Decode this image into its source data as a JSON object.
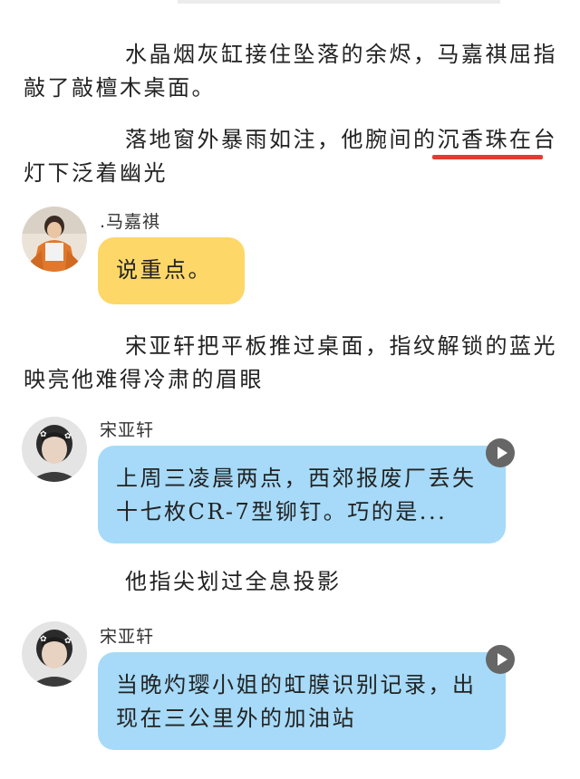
{
  "narration": [
    {
      "text": "水晶烟灰缸接住坠落的余烬，马嘉祺屈指敲了敲檀木桌面。"
    },
    {
      "before": "落地窗外暴雨如注，他腕间的",
      "marked": "沉香珠在",
      "after": "台灯下泛着幽光"
    },
    {
      "text": "宋亚轩把平板推过桌面，指纹解锁的蓝光映亮他难得冷肃的眉眼"
    },
    {
      "text": "他指尖划过全息投影"
    }
  ],
  "messages": [
    {
      "speaker": ".马嘉祺",
      "text": "说重点。",
      "bubble_color": "#fdd868",
      "has_audio": false
    },
    {
      "speaker": "宋亚轩",
      "text": "上周三凌晨两点，西郊报废厂丢失十七枚CR-7型铆钉。巧的是...",
      "bubble_color": "#a6daf8",
      "has_audio": true
    },
    {
      "speaker": "宋亚轩",
      "text": "当晚灼璎小姐的虹膜识别记录，出现在三公里外的加油站",
      "bubble_color": "#a6daf8",
      "has_audio": true
    }
  ],
  "colors": {
    "underline": "#e53935",
    "play_button": "#666666"
  },
  "icons": {
    "play": "play-icon"
  }
}
